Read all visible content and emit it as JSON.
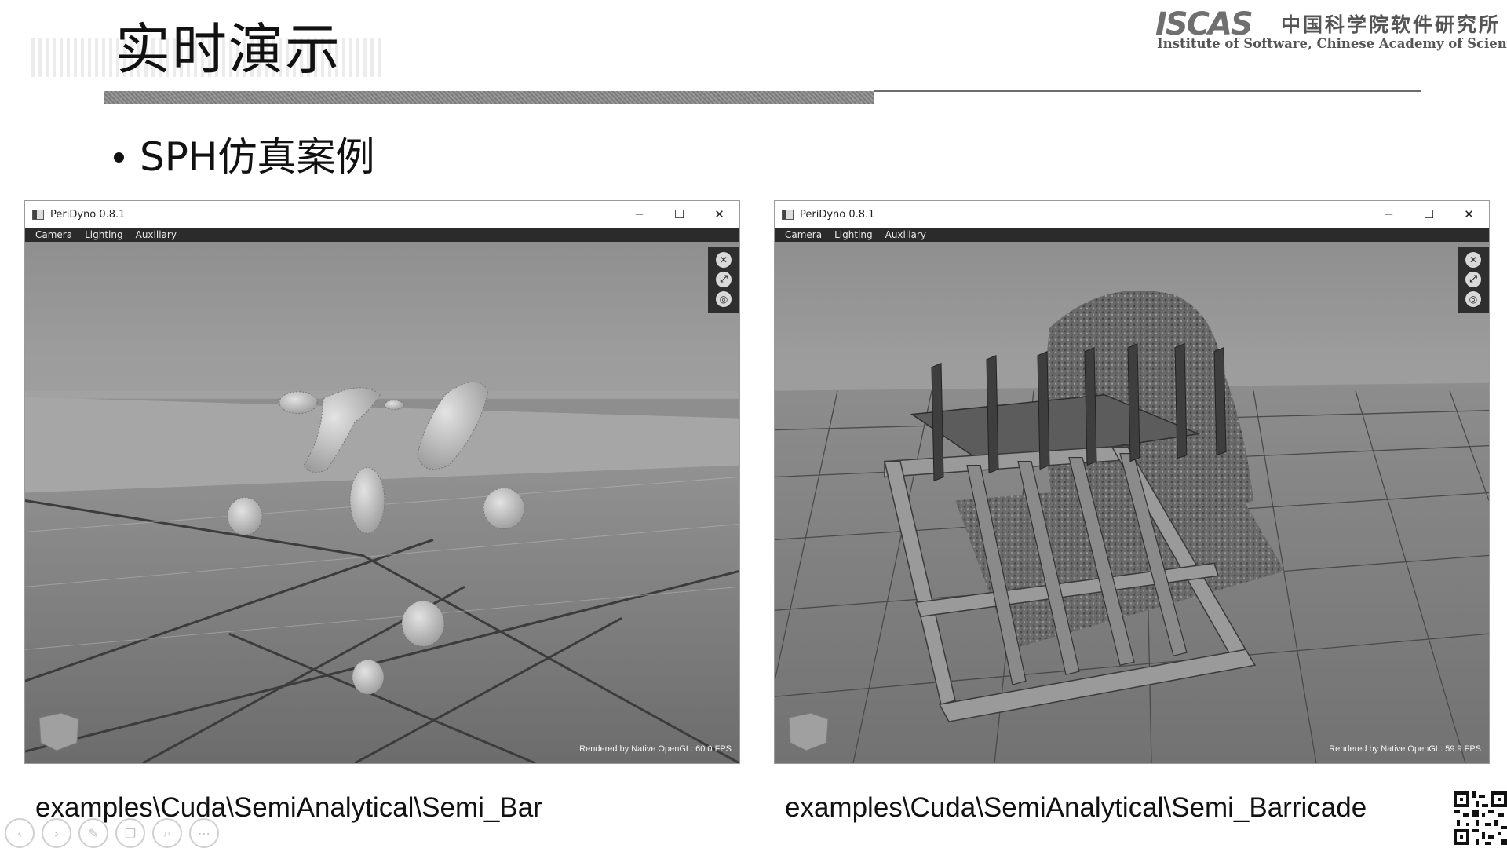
{
  "slide": {
    "title": "实时演示",
    "bullet": "SPH仿真案例"
  },
  "logo": {
    "mark": "ISCAS",
    "chinese": "中国科学院软件研究所",
    "english": "Institute of Software, Chinese Academy of Sciences"
  },
  "windows": [
    {
      "title": "PeriDyno 0.8.1",
      "menu": [
        "Camera",
        "Lighting",
        "Auxiliary"
      ],
      "controls": {
        "minimize": "─",
        "maximize": "☐",
        "close": "✕"
      },
      "toolbox_icons": [
        "fullscreen-icon",
        "expand-icon",
        "globe-icon"
      ],
      "status": "Rendered by Native OpenGL: 60.0 FPS",
      "caption": "examples\\Cuda\\SemiAnalytical\\Semi_Bar"
    },
    {
      "title": "PeriDyno 0.8.1",
      "menu": [
        "Camera",
        "Lighting",
        "Auxiliary"
      ],
      "controls": {
        "minimize": "─",
        "maximize": "☐",
        "close": "✕"
      },
      "toolbox_icons": [
        "fullscreen-icon",
        "expand-icon",
        "globe-icon"
      ],
      "status": "Rendered by Native OpenGL: 59.9 FPS",
      "caption": "examples\\Cuda\\SemiAnalytical\\Semi_Barricade"
    }
  ],
  "player_controls": [
    "prev-icon",
    "next-icon",
    "pen-icon",
    "pages-icon",
    "zoom-icon",
    "more-icon"
  ],
  "colors": {
    "menubar": "#2b2b2b",
    "viewport_bg": "#8e8e8e",
    "title_bar": "#8a8a8a"
  }
}
